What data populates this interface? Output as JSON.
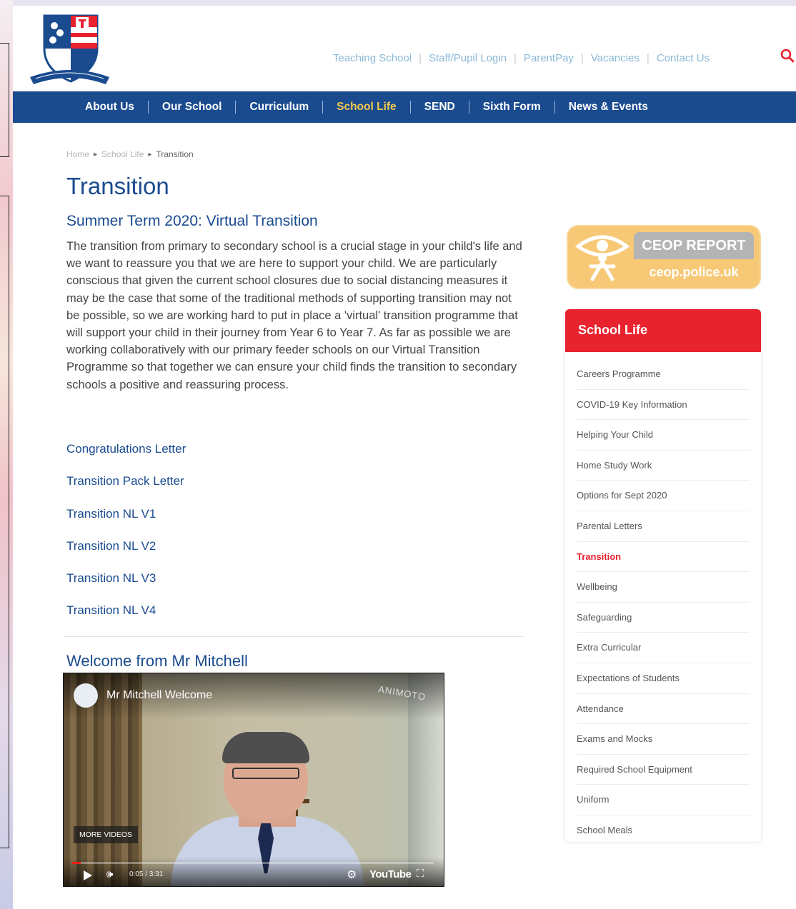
{
  "header": {
    "top_links": [
      "Teaching School",
      "Staff/Pupil Login",
      "ParentPay",
      "Vacancies",
      "Contact Us"
    ]
  },
  "nav": {
    "items": [
      {
        "label": "About Us",
        "active": false
      },
      {
        "label": "Our School",
        "active": false
      },
      {
        "label": "Curriculum",
        "active": false
      },
      {
        "label": "School Life",
        "active": true
      },
      {
        "label": "SEND",
        "active": false
      },
      {
        "label": "Sixth Form",
        "active": false
      },
      {
        "label": "News & Events",
        "active": false
      }
    ]
  },
  "breadcrumb": [
    "Home",
    "School Life",
    "Transition"
  ],
  "main": {
    "title": "Transition",
    "subtitle": "Summer Term 2020: Virtual Transition",
    "intro": "The transition from primary to secondary school is a crucial stage in your child's life and we want to reassure you that we are here to support your child. We are particularly conscious that given the current school closures due to social distancing measures it may be the case that some of the traditional methods of supporting transition may not be possible, so we are working hard to put in place a 'virtual' transition programme that will support your child in their journey from Year 6 to Year 7. As far as possible we are working collaboratively with our primary feeder schools on our Virtual Transition Programme so that together we can ensure your child finds the transition to secondary schools a positive and reassuring process.",
    "documents": [
      "Congratulations Letter",
      "Transition Pack Letter",
      "Transition NL V1",
      "Transition NL V2",
      "Transition NL V3",
      "Transition NL V4"
    ],
    "welcome_heading": "Welcome from Mr Mitchell"
  },
  "video": {
    "title": "Mr Mitchell Welcome",
    "watermark": "ANIMOTO",
    "more_videos": "MORE VIDEOS",
    "time": "0:05 / 3:31",
    "progress": 0.024,
    "brand": "YouTube"
  },
  "ceop": {
    "top": "CEOP REPORT",
    "bottom": "ceop.police.uk"
  },
  "sidebar": {
    "heading": "School Life",
    "items": [
      {
        "label": "Careers Programme",
        "active": false
      },
      {
        "label": "COVID-19 Key Information",
        "active": false
      },
      {
        "label": "Helping Your Child",
        "active": false
      },
      {
        "label": "Home Study Work",
        "active": false
      },
      {
        "label": "Options for Sept 2020",
        "active": false
      },
      {
        "label": "Parental Letters",
        "active": false
      },
      {
        "label": "Transition",
        "active": true
      },
      {
        "label": "Wellbeing",
        "active": false
      },
      {
        "label": "Safeguarding",
        "active": false
      },
      {
        "label": "Extra Curricular",
        "active": false
      },
      {
        "label": "Expectations of Students",
        "active": false
      },
      {
        "label": "Attendance",
        "active": false
      },
      {
        "label": "Exams and Mocks",
        "active": false
      },
      {
        "label": "Required School Equipment",
        "active": false
      },
      {
        "label": "Uniform",
        "active": false
      },
      {
        "label": "School Meals",
        "active": false
      }
    ]
  },
  "colors": {
    "brand_blue": "#1a4b8f",
    "nav_active": "#f2c94c",
    "accent_red": "#e8222e",
    "toplink": "#8ab8d6"
  }
}
